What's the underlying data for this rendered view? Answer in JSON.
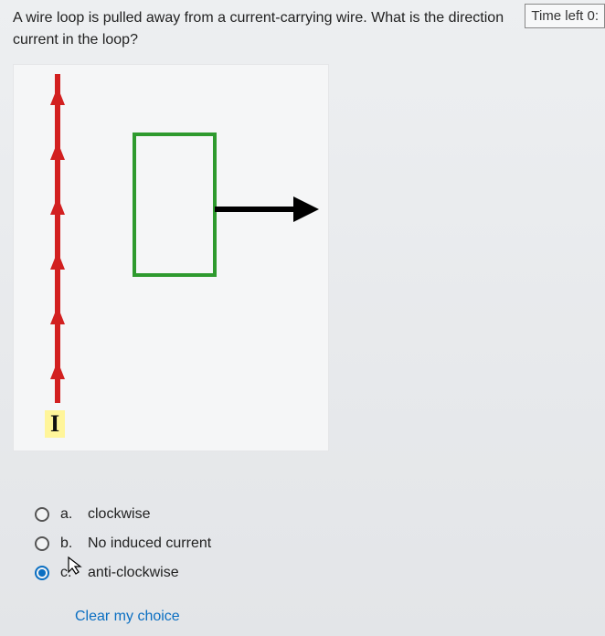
{
  "timer": {
    "label": "Time left 0:"
  },
  "question": {
    "line1": "A wire loop is pulled away from a current-carrying wire. What is the direction",
    "line2": "current in the loop?"
  },
  "diagram": {
    "wire_label": "I"
  },
  "answers": {
    "a": {
      "letter": "a.",
      "text": "clockwise"
    },
    "b": {
      "letter": "b.",
      "text": "No induced current"
    },
    "c": {
      "letter": "c.",
      "text": "anti-clockwise"
    }
  },
  "selected": "c",
  "clear_choice": "Clear my choice"
}
